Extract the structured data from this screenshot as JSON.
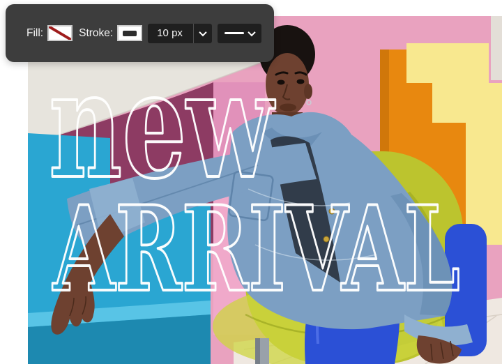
{
  "toolbar": {
    "fill_label": "Fill:",
    "stroke_label": "Stroke:",
    "stroke_width_value": "10 px",
    "icons": {
      "fill_swatch": "fill-none-diagonal-slash",
      "stroke_swatch": "solid-stroke-bar",
      "stroke_width_caret": "chevron-down",
      "stroke_style_preview": "solid-horizontal-line",
      "stroke_style_caret": "chevron-down"
    }
  },
  "artwork": {
    "line1": "new",
    "line2": "ARRIVAL"
  },
  "colors": {
    "toolbar_bg": "#3d3d3d",
    "control_bg": "#1f1f1f",
    "fill_none_red": "#9e1b1b",
    "stroke_bar": "#2d2d2d",
    "pink_wall": "#e9a2bf",
    "pink_block": "#f0a9ca",
    "magenta_wall": "#8d3b63",
    "cyan_block": "#2aa6d2",
    "orange_block": "#e8880f",
    "yellow_stairs": "#f8e88f",
    "arch_cream": "#e7e4dd",
    "floor_white": "#efe8e1",
    "chair_chartreuse": "#bcc42e",
    "denim_blue": "#7c9fc3",
    "boot_blue": "#2b50d6",
    "skin_brown": "#6e4130",
    "text_outline": "#ffffff"
  }
}
